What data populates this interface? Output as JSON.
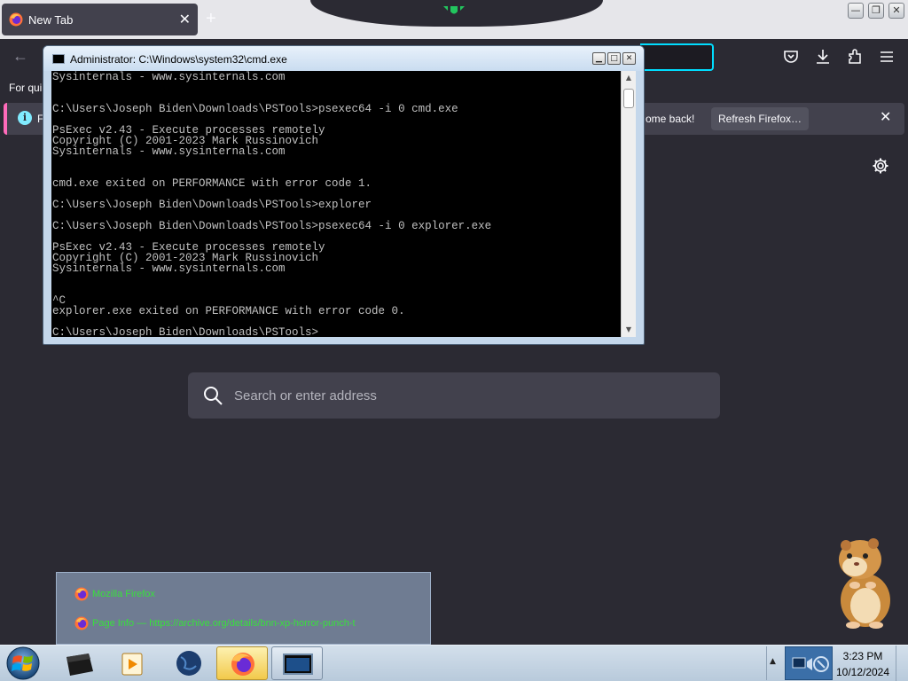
{
  "browser": {
    "tab": {
      "title": "New Tab",
      "close_glyph": "✕",
      "icon": "firefox-icon"
    },
    "new_tab_glyph": "+",
    "window_controls": {
      "minimize": "—",
      "restore": "❐",
      "close": "✕"
    },
    "back_glyph": "←",
    "toolbar_icons": [
      "pocket-icon",
      "download-icon",
      "extensions-icon",
      "menu-icon"
    ],
    "bookmarks_hint": "For qui",
    "notification": {
      "icon": "info-icon",
      "info_glyph": "i",
      "leading_fragment": "F",
      "message_fragment": "ome back!",
      "refresh_label": "Refresh Firefox…",
      "close_glyph": "✕"
    },
    "settings_icon": "gear-icon",
    "search": {
      "placeholder": "Search or enter address",
      "icon": "search-icon"
    }
  },
  "cmd_window": {
    "title": "Administrator: C:\\Windows\\system32\\cmd.exe",
    "controls": {
      "minimize": "▁",
      "maximize": "□",
      "close": "✕"
    },
    "scroll_up_glyph": "▲",
    "scroll_down_glyph": "▼",
    "lines": [
      "Sysinternals - www.sysinternals.com",
      "",
      "",
      "C:\\Users\\Joseph Biden\\Downloads\\PSTools>psexec64 -i 0 cmd.exe",
      "",
      "PsExec v2.43 - Execute processes remotely",
      "Copyright (C) 2001-2023 Mark Russinovich",
      "Sysinternals - www.sysinternals.com",
      "",
      "",
      "cmd.exe exited on PERFORMANCE with error code 1.",
      "",
      "C:\\Users\\Joseph Biden\\Downloads\\PSTools>explorer",
      "",
      "C:\\Users\\Joseph Biden\\Downloads\\PSTools>psexec64 -i 0 explorer.exe",
      "",
      "PsExec v2.43 - Execute processes remotely",
      "Copyright (C) 2001-2023 Mark Russinovich",
      "Sysinternals - www.sysinternals.com",
      "",
      "",
      "^C",
      "explorer.exe exited on PERFORMANCE with error code 0.",
      "",
      "C:\\Users\\Joseph Biden\\Downloads\\PSTools>"
    ]
  },
  "taskbar_preview": {
    "items": [
      {
        "icon": "firefox-icon",
        "text": "Mozilla Firefox"
      },
      {
        "icon": "firefox-icon",
        "text": "Page Info — https://archive.org/details/bnn-xp-horror-punch-t"
      }
    ]
  },
  "taskbar": {
    "start_icon": "windows-start-icon",
    "pinned": [
      "terminal-box-icon",
      "media-player-icon",
      "globe-icon",
      "firefox-icon",
      "cmd-icon"
    ],
    "tray_expand_glyph": "▲",
    "clock": {
      "time": "3:23 PM",
      "date": "10/12/2024"
    }
  },
  "colors": {
    "firefox_bg": "#2b2a33",
    "firefox_panel": "#42414d",
    "accent_cyan": "#00ddff",
    "notif_stripe": "#ff6bba",
    "console_bg": "#000000",
    "console_text": "#c0c0c0",
    "preview_text_green": "#38e03c",
    "taskbar_active": "#f2c94b"
  }
}
